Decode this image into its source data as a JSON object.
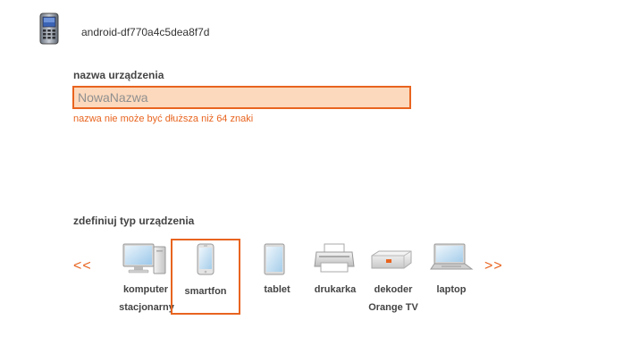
{
  "header": {
    "device_id": "android-df770a4c5dea8f7d",
    "device_icon": "smartphone-icon"
  },
  "name_form": {
    "label": "nazwa urządzenia",
    "value": "NowaNazwa",
    "error": "nazwa nie może być dłuższa niż 64 znaki"
  },
  "type_selector": {
    "label": "zdefiniuj typ urządzenia",
    "prev": "<<",
    "next": ">>",
    "selected": "smartfon",
    "types": [
      {
        "line1": "komputer",
        "line2": "stacjonarny",
        "icon": "desktop-computer-icon"
      },
      {
        "line1": "smartfon",
        "line2": "",
        "icon": "smartphone-icon"
      },
      {
        "line1": "tablet",
        "line2": "",
        "icon": "tablet-icon"
      },
      {
        "line1": "drukarka",
        "line2": "",
        "icon": "printer-icon"
      },
      {
        "line1": "dekoder",
        "line2": "Orange TV",
        "icon": "set-top-box-icon"
      },
      {
        "line1": "laptop",
        "line2": "",
        "icon": "laptop-icon"
      }
    ]
  }
}
